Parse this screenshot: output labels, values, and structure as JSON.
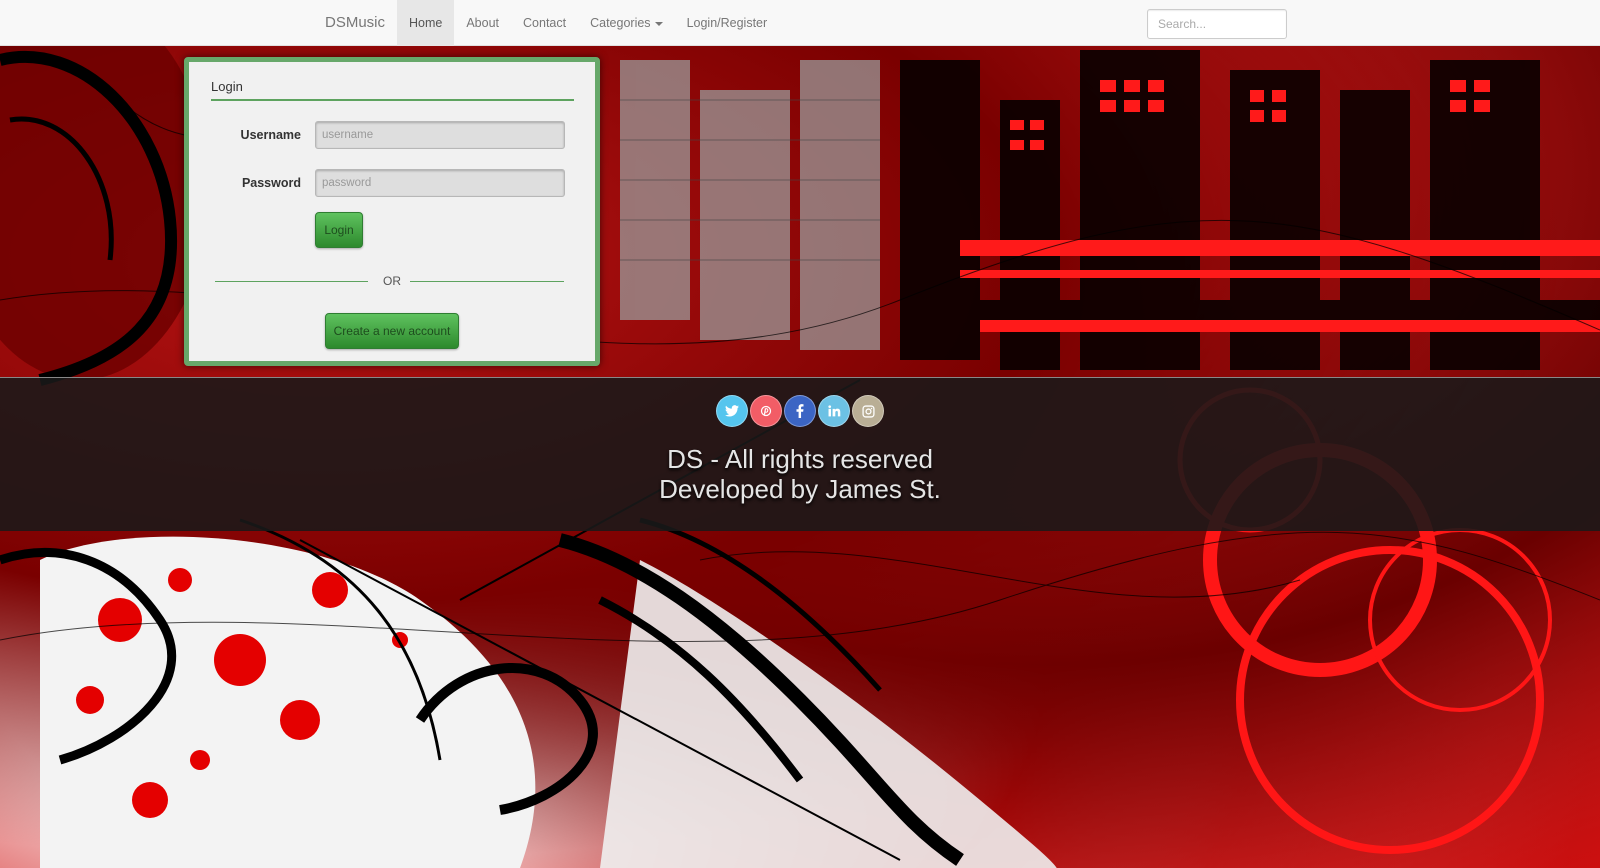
{
  "navbar": {
    "brand": "DSMusic",
    "links": [
      {
        "label": "Home",
        "active": true
      },
      {
        "label": "About"
      },
      {
        "label": "Contact"
      },
      {
        "label": "Categories",
        "dropdown": true
      },
      {
        "label": "Login/Register"
      }
    ],
    "search": {
      "placeholder": "Search...",
      "value": ""
    }
  },
  "login": {
    "title": "Login",
    "username": {
      "label": "Username",
      "placeholder": "username",
      "value": ""
    },
    "password": {
      "label": "Password",
      "placeholder": "password",
      "value": ""
    },
    "login_button": "Login",
    "or_text": "OR",
    "create_account_button": "Create a new account"
  },
  "footer": {
    "social": [
      {
        "name": "twitter",
        "color": "#55c5ee"
      },
      {
        "name": "pinterest",
        "color": "#f25d66"
      },
      {
        "name": "facebook",
        "color": "#3b65c4"
      },
      {
        "name": "linkedin",
        "color": "#6cc1e4"
      },
      {
        "name": "instagram",
        "color": "#b9ae95"
      }
    ],
    "line1": "DS - All rights reserved",
    "line2": "Developed by James St."
  },
  "colors": {
    "accent_green": "#67a86a",
    "button_green": "#3a9a3a",
    "background_red": "#d10e0e"
  }
}
